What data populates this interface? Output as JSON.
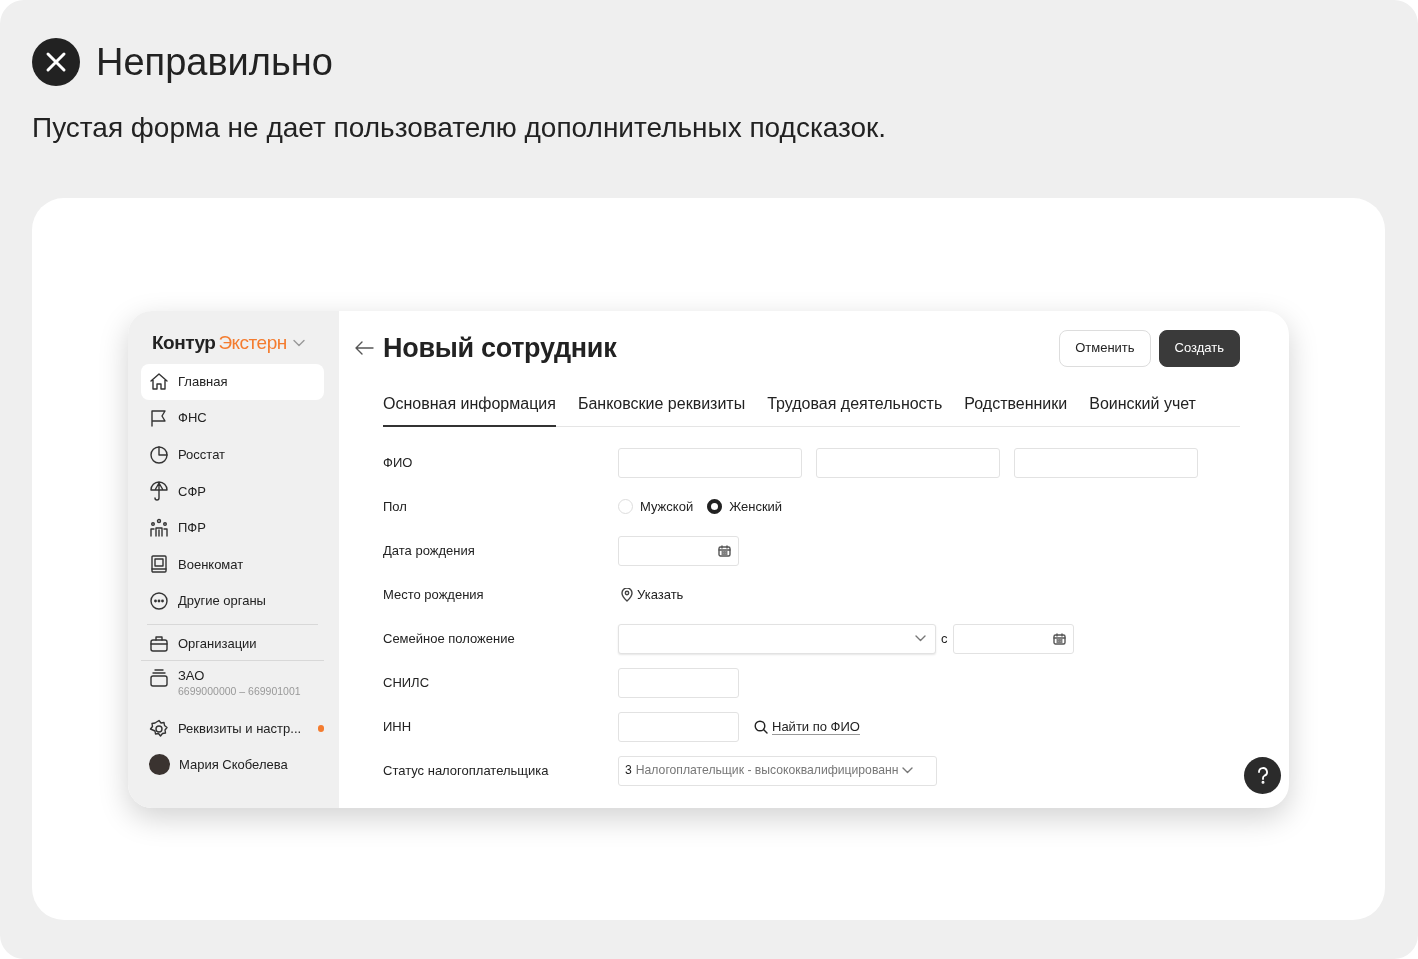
{
  "verdict": {
    "kind": "wrong",
    "title": "Неправильно",
    "description": "Пустая форма не дает пользователю дополнительных подсказок."
  },
  "app": {
    "brand": {
      "first": "Контур",
      "second": "Экстерн"
    },
    "sidebar": {
      "items": [
        {
          "label": "Главная",
          "selected": true
        },
        {
          "label": "ФНС",
          "selected": false
        },
        {
          "label": "Росстат",
          "selected": false
        },
        {
          "label": "СФР",
          "selected": false
        },
        {
          "label": "ПФР",
          "selected": false
        },
        {
          "label": "Военкомат",
          "selected": false
        },
        {
          "label": "Другие органы",
          "selected": false
        }
      ],
      "organizations": {
        "label": "Организации"
      },
      "company": {
        "name": "ЗАО",
        "codes": "6699000000 – 669901001"
      },
      "settings": {
        "label": "Реквизиты и настр...",
        "notification": true
      },
      "user": {
        "name": "Мария Скобелева"
      }
    },
    "header": {
      "title": "Новый сотрудник",
      "buttons": [
        {
          "label": "Отменить",
          "kind": "secondary"
        },
        {
          "label": "Создать",
          "kind": "primary"
        }
      ]
    },
    "tabs": [
      {
        "label": "Основная информация",
        "selected": true
      },
      {
        "label": "Банковские реквизиты",
        "selected": false
      },
      {
        "label": "Трудовая деятельность",
        "selected": false
      },
      {
        "label": "Родственники",
        "selected": false
      },
      {
        "label": "Воинский учет",
        "selected": false
      }
    ],
    "form": [
      {
        "kind": "name_fields",
        "label": "ФИО"
      },
      {
        "kind": "radio",
        "label": "Пол",
        "options": [
          {
            "label": "Мужской",
            "selected": false
          },
          {
            "label": "Женский",
            "selected": true
          }
        ]
      },
      {
        "kind": "date",
        "label": "Дата рождения"
      },
      {
        "kind": "place_link",
        "label": "Место рождения",
        "link": "Указать"
      },
      {
        "kind": "select_date",
        "label": "Семейное положение",
        "connector": "с"
      },
      {
        "kind": "text",
        "label": "СНИЛС"
      },
      {
        "kind": "text_search",
        "label": "ИНН",
        "link": "Найти по ФИО"
      },
      {
        "kind": "select",
        "label": "Статус налогоплательщика",
        "code": "3",
        "value": "Налогоплательщик - высококвалифицированн"
      }
    ]
  }
}
